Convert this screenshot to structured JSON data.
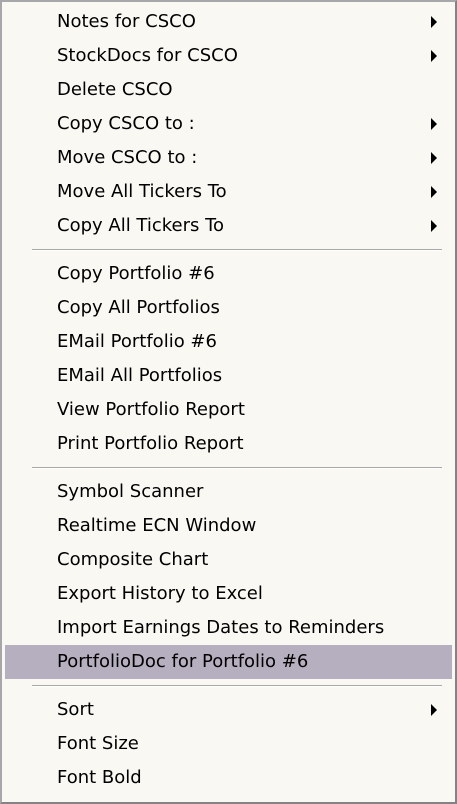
{
  "menu": {
    "group1": [
      {
        "label": "Notes for CSCO",
        "submenu": true
      },
      {
        "label": "StockDocs for CSCO",
        "submenu": true
      },
      {
        "label": "Delete CSCO",
        "submenu": false
      },
      {
        "label": "Copy CSCO to :",
        "submenu": true
      },
      {
        "label": "Move CSCO to :",
        "submenu": true
      },
      {
        "label": "Move All Tickers To",
        "submenu": true
      },
      {
        "label": "Copy All Tickers To",
        "submenu": true
      }
    ],
    "group2": [
      {
        "label": "Copy Portfolio #6",
        "submenu": false
      },
      {
        "label": "Copy All Portfolios",
        "submenu": false
      },
      {
        "label": "EMail Portfolio #6",
        "submenu": false
      },
      {
        "label": "EMail All Portfolios",
        "submenu": false
      },
      {
        "label": "View Portfolio Report",
        "submenu": false
      },
      {
        "label": "Print Portfolio Report",
        "submenu": false
      }
    ],
    "group3": [
      {
        "label": "Symbol Scanner",
        "submenu": false
      },
      {
        "label": "Realtime ECN Window",
        "submenu": false
      },
      {
        "label": "Composite Chart",
        "submenu": false
      },
      {
        "label": "Export History to Excel",
        "submenu": false
      },
      {
        "label": "Import Earnings Dates to Reminders",
        "submenu": false
      },
      {
        "label": "PortfolioDoc for Portfolio #6",
        "submenu": false,
        "selected": true
      }
    ],
    "group4": [
      {
        "label": "Sort",
        "submenu": true
      },
      {
        "label": "Font Size",
        "submenu": false
      },
      {
        "label": "Font Bold",
        "submenu": false
      }
    ]
  },
  "colors": {
    "menu_background": "#f9f8f3",
    "selection_highlight": "#b6afbf",
    "separator": "#a8a8a8",
    "text": "#000000"
  },
  "icons": {
    "submenu_arrow": "submenu-arrow-icon"
  }
}
